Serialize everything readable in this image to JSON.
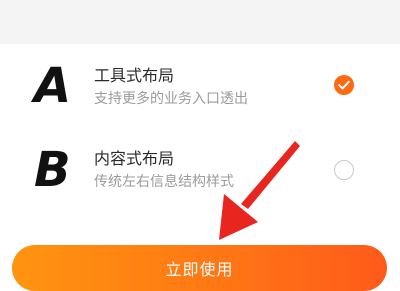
{
  "options": [
    {
      "letter": "A",
      "title": "工具式布局",
      "subtitle": "支持更多的业务入口透出",
      "selected": true
    },
    {
      "letter": "B",
      "title": "内容式布局",
      "subtitle": "传统左右信息结构样式",
      "selected": false
    }
  ],
  "primary_button": {
    "label": "立即使用"
  },
  "colors": {
    "accent": "#fb6a12",
    "button_gradient_start": "#ff9410",
    "button_gradient_end": "#ff5a1a",
    "arrow": "#e8261f"
  },
  "icons": [
    "check-icon",
    "annotation-arrow"
  ]
}
